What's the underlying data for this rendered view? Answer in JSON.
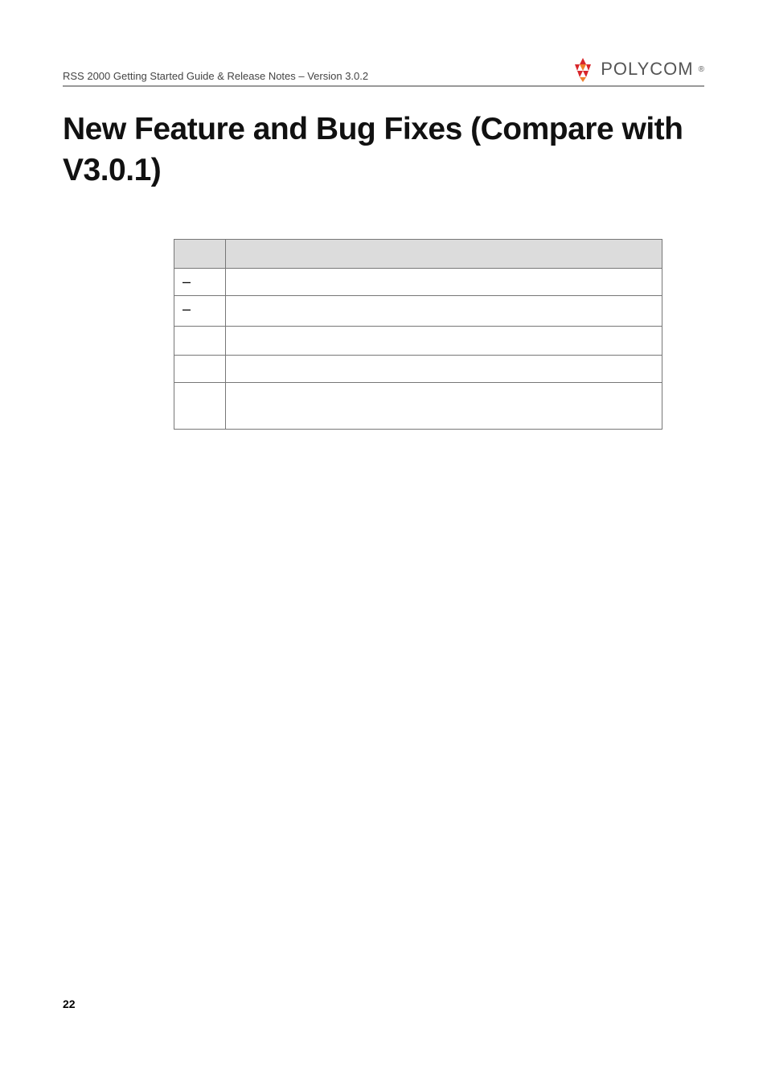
{
  "header": {
    "doc_title": "RSS 2000 Getting Started Guide & Release Notes – Version 3.0.2",
    "brand": "POLYCOM",
    "brand_tm": "®"
  },
  "heading": "New Feature and Bug Fixes (Compare with V3.0.1)",
  "table": {
    "columns": [
      "",
      ""
    ],
    "rows": [
      {
        "index": "–",
        "desc": ""
      },
      {
        "index": "–",
        "desc": ""
      },
      {
        "index": "",
        "desc": ""
      },
      {
        "index": "",
        "desc": ""
      },
      {
        "index": "",
        "desc": ""
      }
    ]
  },
  "page_number": "22"
}
